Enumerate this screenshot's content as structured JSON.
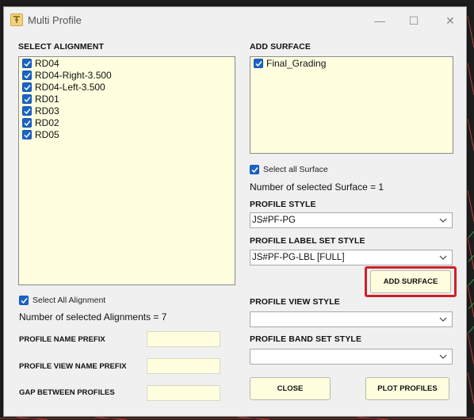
{
  "window": {
    "title": "Multi Profile",
    "min_glyph": "—",
    "max_glyph": "☐",
    "close_glyph": "✕"
  },
  "alignment": {
    "header": "SELECT ALIGNMENT",
    "items": [
      {
        "label": "RD04",
        "checked": true
      },
      {
        "label": "RD04-Right-3.500",
        "checked": true
      },
      {
        "label": "RD04-Left-3.500",
        "checked": true
      },
      {
        "label": "RD01",
        "checked": true
      },
      {
        "label": "RD03",
        "checked": true
      },
      {
        "label": "RD02",
        "checked": true
      },
      {
        "label": "RD05",
        "checked": true
      }
    ],
    "select_all_label": "Select All Alignment",
    "count_text": "Number of selected Alignments = 7"
  },
  "surface": {
    "header": "ADD SURFACE",
    "items": [
      {
        "label": "Final_Grading",
        "checked": true
      }
    ],
    "select_all_label": "Select all Surface",
    "count_text": "Number of selected Surface = 1"
  },
  "profile_style": {
    "label": "PROFILE STYLE",
    "value": "JS#PF-PG"
  },
  "profile_label_set_style": {
    "label": "PROFILE LABEL SET STYLE",
    "value": "JS#PF-PG-LBL [FULL]"
  },
  "add_surface_button": "ADD SURFACE",
  "profile_view_style": {
    "label": "PROFILE VIEW STYLE",
    "value": ""
  },
  "profile_band_set_style": {
    "label": "PROFILE BAND SET STYLE",
    "value": ""
  },
  "fields": {
    "profile_name_prefix": {
      "label": "PROFILE NAME PREFIX",
      "value": ""
    },
    "profile_view_name_prefix": {
      "label": "PROFILE VIEW NAME PREFIX",
      "value": ""
    },
    "gap_between_profiles": {
      "label": "GAP BETWEEN PROFILES",
      "value": ""
    }
  },
  "buttons": {
    "close": "CLOSE",
    "plot_profiles": "PLOT PROFILES"
  },
  "colors": {
    "list_background": "#ffffe0",
    "checkbox_blue": "#1a63c7",
    "highlight_red": "#d0202a"
  }
}
